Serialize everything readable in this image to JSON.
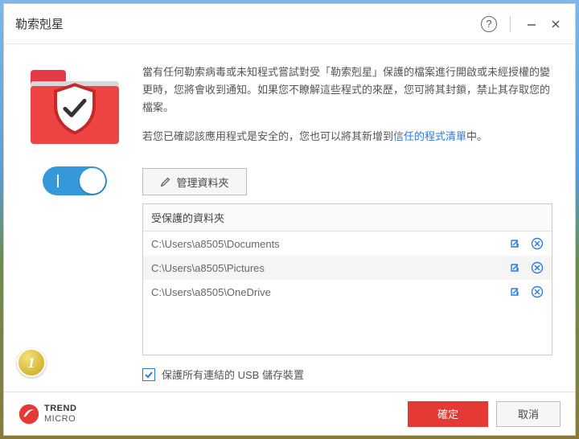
{
  "title": "勒索剋星",
  "description_part1": "當有任何勒索病毒或未知程式嘗試對受「勒索剋星」保護的檔案進行開啟或未經授權的變更時，您將會收到通知。如果您不瞭解這些程式的來歷，您可將其封鎖，禁止其存取您的檔案。",
  "description_part2_prefix": "若您已確認該應用程式是安全的，您也可以將其新增到",
  "description_part2_link": "信任的程式清單",
  "description_part2_suffix": "中。",
  "manage_button": "管理資料夾",
  "list_header": "受保護的資料夾",
  "folders": [
    "C:\\Users\\a8505\\Documents",
    "C:\\Users\\a8505\\Pictures",
    "C:\\Users\\a8505\\OneDrive"
  ],
  "usb_checkbox_label": "保護所有連結的 USB 儲存裝置",
  "usb_checked": true,
  "toggle_on": true,
  "brand_line1": "TREND",
  "brand_line2": "MICRO",
  "ok_button": "確定",
  "cancel_button": "取消",
  "step_number": "1",
  "colors": {
    "primary_red": "#e53935",
    "link_blue": "#2a7ae2",
    "toggle_blue": "#3498db"
  }
}
